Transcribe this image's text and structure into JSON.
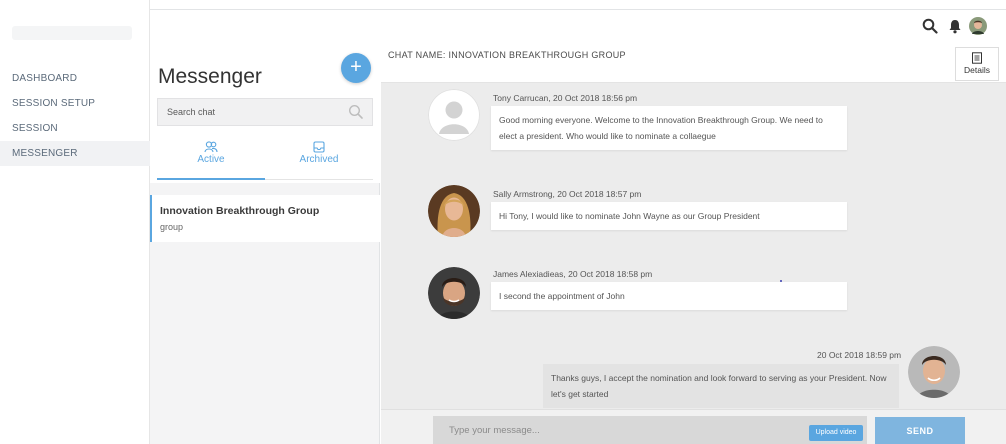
{
  "nav": {
    "items": [
      {
        "label": "DASHBOARD"
      },
      {
        "label": "SESSION SETUP"
      },
      {
        "label": "SESSION"
      },
      {
        "label": "MESSENGER"
      }
    ]
  },
  "topbar": {
    "icons": [
      "search-icon",
      "bell-icon",
      "avatar"
    ]
  },
  "messenger": {
    "title": "Messenger",
    "add_label": "+",
    "search_placeholder": "Search chat",
    "tabs": [
      {
        "label": "Active",
        "icon": "users-icon"
      },
      {
        "label": "Archived",
        "icon": "archive-icon"
      }
    ],
    "conversations": [
      {
        "name": "Innovation Breakthrough Group",
        "type": "group"
      }
    ]
  },
  "chat": {
    "title": "CHAT NAME: INNOVATION BREAKTHROUGH GROUP",
    "details_label": "Details",
    "messages": [
      {
        "meta": "Tony Carrucan, 20 Oct 2018 18:56 pm",
        "text": "Good morning everyone. Welcome to the Innovation Breakthrough Group. We need to elect a president. Who would like to nominate a collaegue"
      },
      {
        "meta": "Sally Armstrong, 20 Oct 2018 18:57 pm",
        "text": "Hi Tony, I would like to nominate John Wayne as our Group President"
      },
      {
        "meta": "James Alexiadieas, 20 Oct 2018 18:58 pm",
        "text": "I second the appointment of John"
      },
      {
        "meta": "20 Oct 2018 18:59 pm",
        "text": "Thanks guys, I accept the nomination and look forward to serving as your President. Now let's get started"
      }
    ],
    "composer_placeholder": "Type your message...",
    "upload_label": "Upload video",
    "send_label": "SEND"
  },
  "colors": {
    "accent": "#5aa6e0",
    "chat_bg": "#ececec"
  }
}
